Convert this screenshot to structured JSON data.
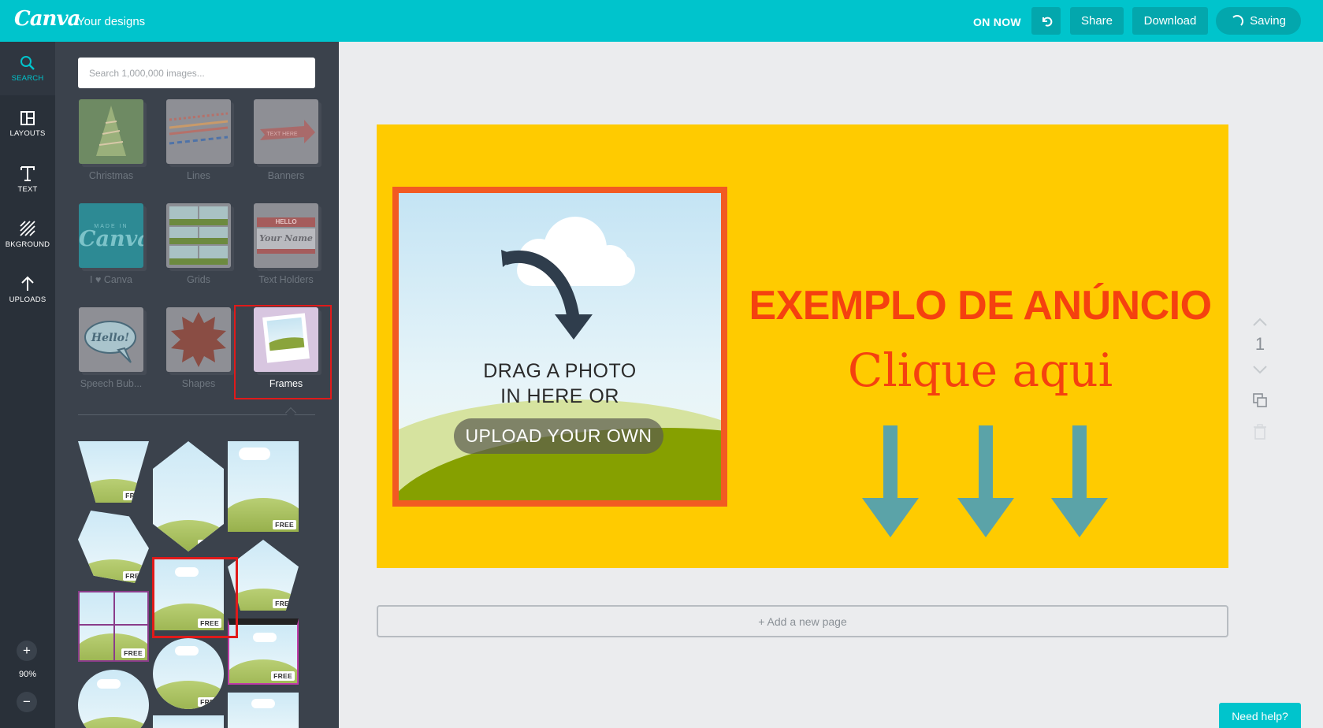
{
  "topbar": {
    "logo": "Canva",
    "your_designs": "Your designs",
    "on_now": "ON NOW",
    "share": "Share",
    "download": "Download",
    "saving": "Saving"
  },
  "rail": {
    "search": "SEARCH",
    "layouts": "LAYOUTS",
    "text": "TEXT",
    "background": "BKGROUND",
    "uploads": "UPLOADS",
    "zoom_in": "+",
    "zoom_out": "−",
    "zoom": "90%"
  },
  "panel": {
    "search_placeholder": "Search 1,000,000 images...",
    "categories": [
      {
        "label": "Christmas"
      },
      {
        "label": "Lines"
      },
      {
        "label": "Banners"
      },
      {
        "label": "I ♥ Canva"
      },
      {
        "label": "Grids"
      },
      {
        "label": "Text Holders"
      },
      {
        "label": "Speech Bub..."
      },
      {
        "label": "Shapes"
      },
      {
        "label": "Frames"
      }
    ],
    "thumb_text": {
      "banner": "TEXT HERE",
      "canva_made_in": "MADE IN",
      "canva_logo": "Canva",
      "hello": "HELLO",
      "your_name": "Your Name",
      "speech": "Hello!"
    },
    "free_badge": "FREE"
  },
  "design": {
    "drag_line1": "DRAG A PHOTO",
    "drag_line2": "IN HERE OR",
    "upload": "UPLOAD YOUR OWN",
    "headline": "EXEMPLO DE ANÚNCIO",
    "subline": "Clique aqui",
    "bg_color": "#ffcb00",
    "accent_color": "#f5410f",
    "arrow_color": "#5ba3a8"
  },
  "add_page": "+ Add a new page",
  "page_number": "1",
  "help": "Need help?",
  "colors": {
    "brand": "#00c4cc",
    "rail_bg": "#293039",
    "panel_bg": "#3b424c"
  }
}
